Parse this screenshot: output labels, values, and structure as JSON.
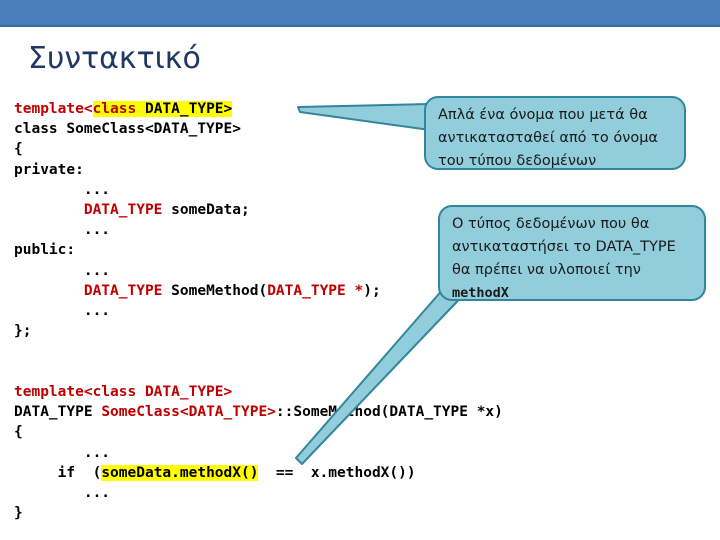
{
  "slide": {
    "title": "Συντακτικό",
    "banner_color": "#4a7ebb",
    "title_color": "#1f3864",
    "background_color": "#ffffff"
  },
  "code_top": {
    "lines": [
      [
        {
          "text": "template<",
          "color": "red",
          "highlight": false
        },
        {
          "text": "class ",
          "color": "red",
          "highlight": true
        },
        {
          "text": "DATA_TYPE>",
          "color": "black",
          "highlight": true
        }
      ],
      [
        {
          "text": "class SomeClass<DATA_TYPE>",
          "color": "black",
          "highlight": false
        }
      ],
      [
        {
          "text": "{",
          "color": "black",
          "highlight": false
        }
      ],
      [
        {
          "text": "private:",
          "color": "black",
          "highlight": false
        }
      ],
      [
        {
          "text": "        ...",
          "color": "black",
          "highlight": false
        }
      ],
      [
        {
          "text": "        ",
          "color": "black",
          "highlight": false
        },
        {
          "text": "DATA_TYPE",
          "color": "red",
          "highlight": false
        },
        {
          "text": " someData;",
          "color": "black",
          "highlight": false
        }
      ],
      [
        {
          "text": "        ...",
          "color": "black",
          "highlight": false
        }
      ],
      [
        {
          "text": "public:",
          "color": "black",
          "highlight": false
        }
      ],
      [
        {
          "text": "        ...",
          "color": "black",
          "highlight": false
        }
      ],
      [
        {
          "text": "        ",
          "color": "black",
          "highlight": false
        },
        {
          "text": "DATA_TYPE",
          "color": "red",
          "highlight": false
        },
        {
          "text": " SomeMethod(",
          "color": "black",
          "highlight": false
        },
        {
          "text": "DATA_TYPE *",
          "color": "red",
          "highlight": false
        },
        {
          "text": ");",
          "color": "black",
          "highlight": false
        }
      ],
      [
        {
          "text": "        ...",
          "color": "black",
          "highlight": false
        }
      ],
      [
        {
          "text": "};",
          "color": "black",
          "highlight": false
        }
      ]
    ]
  },
  "code_bottom": {
    "lines": [
      [
        {
          "text": "template<class DATA_TYPE>",
          "color": "red",
          "highlight": false
        }
      ],
      [
        {
          "text": "DATA_TYPE ",
          "color": "black",
          "highlight": false
        },
        {
          "text": "SomeClass<DATA_TYPE>",
          "color": "red",
          "highlight": false
        },
        {
          "text": "::SomeMethod(DATA_TYPE *x)",
          "color": "black",
          "highlight": false
        }
      ],
      [
        {
          "text": "{",
          "color": "black",
          "highlight": false
        }
      ],
      [
        {
          "text": "        ...",
          "color": "black",
          "highlight": false
        }
      ],
      [
        {
          "text": "     if  (",
          "color": "black",
          "highlight": false
        },
        {
          "text": "someData.methodX()",
          "color": "black",
          "highlight": true
        },
        {
          "text": "  ==  x.methodX())",
          "color": "black",
          "highlight": false
        }
      ],
      [
        {
          "text": "        ...",
          "color": "black",
          "highlight": false
        }
      ],
      [
        {
          "text": "}",
          "color": "black",
          "highlight": false
        }
      ]
    ]
  },
  "callouts": [
    {
      "id": "callout-1",
      "lines": [
        {
          "text": "Απλά ένα όνομα που μετά θα",
          "mono": false
        },
        {
          "text": "αντικατασταθεί από το όνομα",
          "mono": false
        },
        {
          "text": "του τύπου δεδομένων",
          "mono": false
        }
      ],
      "fill_color": "#92cddc",
      "border_color": "#31859c"
    },
    {
      "id": "callout-2",
      "lines": [
        {
          "text": "Ο τύπος δεδομένων που θα",
          "mono": false
        },
        {
          "text": "αντικαταστήσει το DATA_TYPE",
          "mono": false
        },
        {
          "text": "θα πρέπει να υλοποιεί την",
          "mono": false
        },
        {
          "text": "methodX",
          "mono": true
        }
      ],
      "fill_color": "#92cddc",
      "border_color": "#31859c"
    }
  ],
  "colors": {
    "code_keyword_red": "#c00000",
    "code_text_black": "#000000",
    "highlight_yellow": "#ffff00",
    "callout_fill": "#92cddc",
    "callout_border": "#31859c",
    "banner_blue": "#4a7ebb",
    "title_navy": "#1f3864"
  }
}
